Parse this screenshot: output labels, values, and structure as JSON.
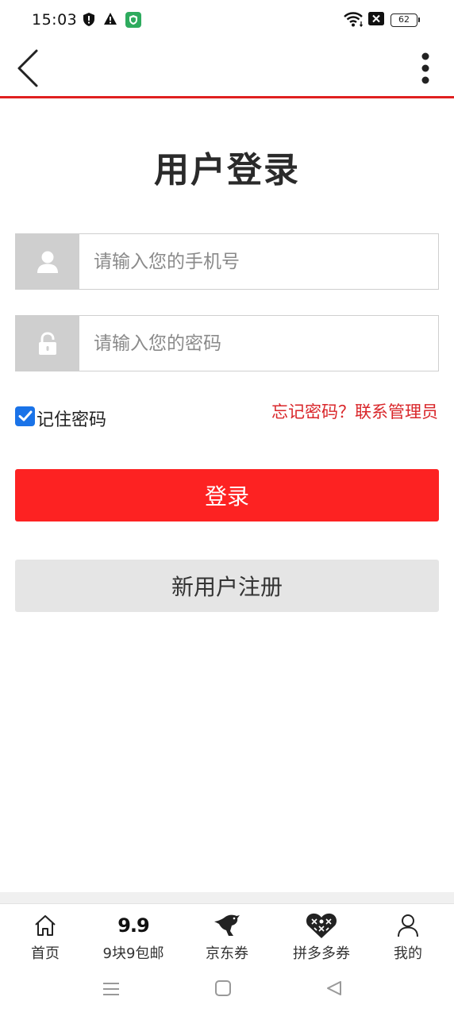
{
  "status_bar": {
    "time": "15:03",
    "battery": "62",
    "icons": [
      "shield-icon",
      "warning-icon",
      "vpn-shield-icon",
      "wifi-icon",
      "sim-off-icon",
      "battery-icon"
    ]
  },
  "header": {
    "back_icon": "chevron-left-icon",
    "more_icon": "more-vertical-icon",
    "accent_color": "#e02020"
  },
  "login": {
    "title": "用户登录",
    "phone_placeholder": "请输入您的手机号",
    "password_placeholder": "请输入您的密码",
    "remember_label": "记住密码",
    "remember_checked": true,
    "forgot_link": "忘记密码？联系管理员",
    "login_button": "登录",
    "register_button": "新用户注册"
  },
  "colors": {
    "primary": "#fd2222",
    "link": "#d9262a",
    "secondary_button": "#e5e5e5",
    "icon_box": "#cfcfcf"
  },
  "bottom_nav": {
    "items": [
      {
        "label": "首页",
        "icon": "home-icon"
      },
      {
        "label": "9块9包邮",
        "icon": "nine-nine-icon",
        "icon_text": "9.9"
      },
      {
        "label": "京东券",
        "icon": "jd-bird-icon"
      },
      {
        "label": "拼多多券",
        "icon": "pdd-heart-icon"
      },
      {
        "label": "我的",
        "icon": "user-icon"
      }
    ]
  },
  "system_nav": [
    "menu-icon",
    "home-square-icon",
    "back-triangle-icon"
  ]
}
